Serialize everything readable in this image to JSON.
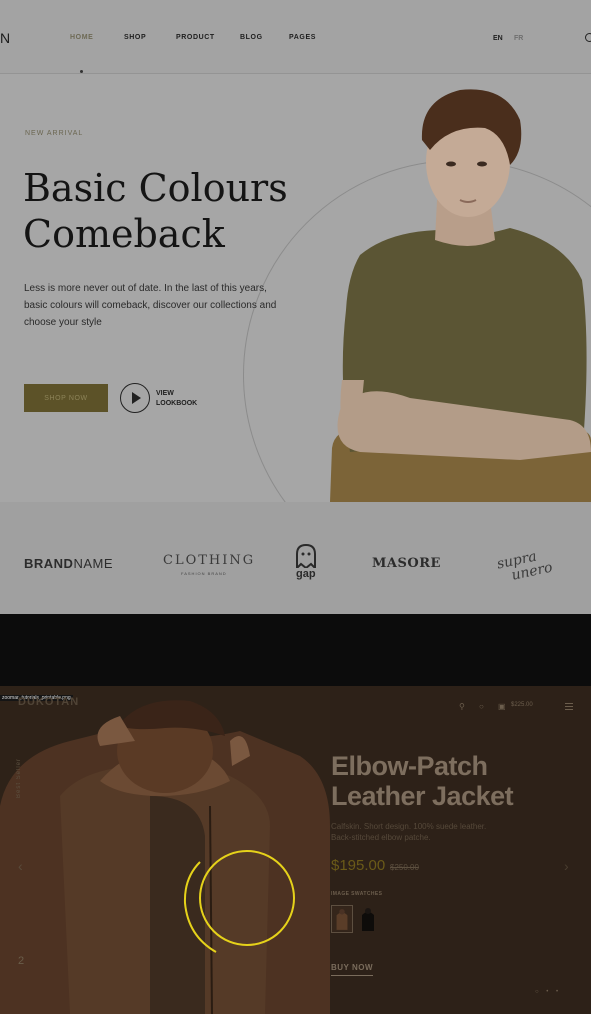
{
  "nav": {
    "logo_fragment": "N",
    "items": [
      {
        "label": "HOME",
        "active": true
      },
      {
        "label": "SHOP",
        "active": false
      },
      {
        "label": "PRODUCT",
        "active": false
      },
      {
        "label": "BLOG",
        "active": false
      },
      {
        "label": "PAGES",
        "active": false
      }
    ],
    "languages": [
      "EN",
      "FR"
    ]
  },
  "hero": {
    "eyebrow": "NEW ARRIVAL",
    "title_line1": "Basic Colours",
    "title_line2": "Comeback",
    "description": "Less is more never out of date. In the last of this years, basic colours will comeback, discover our collections and choose your style",
    "shop_button": "SHOP NOW",
    "lookbook_line1": "VIEW",
    "lookbook_line2": "LOOKBOOK"
  },
  "brands": {
    "brand1_bold": "BRAND",
    "brand1_light": "NAME",
    "brand2": "CLOTHING",
    "brand2_sub": "FASHION BRAND",
    "brand3": "gap",
    "brand4": "MASORE",
    "brand5_line1": "supra",
    "brand5_line2": "unero"
  },
  "product": {
    "file_label": "zoomar_tutorials_printable.png",
    "store_logo": "DUKOTAN",
    "vertical_text": "Best Seller",
    "slide_number": "2",
    "cart_total": "$225.00",
    "title_line1": "Elbow-Patch",
    "title_line2": "Leather Jacket",
    "description": "Calfskin. Short design. 100% suede leather. Back-stitched elbow patche.",
    "price": "$195.00",
    "old_price": "$250.00",
    "swatch_label": "IMAGE SWATCHES",
    "buy_now": "BUY NOW",
    "pagination": "○ • •"
  },
  "colors": {
    "accent": "#5c5228",
    "spinner": "#e6d21a",
    "product_bg": "#2d2118"
  }
}
